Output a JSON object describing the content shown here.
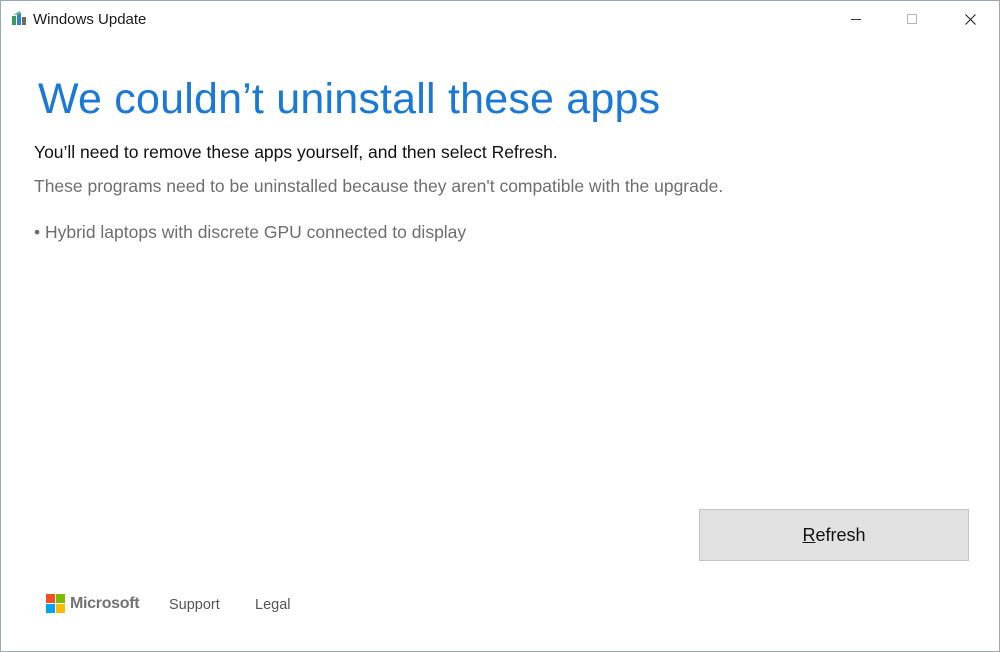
{
  "window": {
    "title": "Windows Update",
    "app_icon": "windows-update-icon",
    "controls": {
      "minimize_icon": "minimize-icon",
      "maximize_icon": "maximize-icon",
      "close_icon": "close-icon"
    }
  },
  "content": {
    "headline": "We couldn’t uninstall these apps",
    "instruction": "You’ll need to remove these apps yourself, and then select Refresh.",
    "explanation": "These programs need to be uninstalled because they aren't compatible with the upgrade.",
    "apps": [
      "• Hybrid laptops with discrete GPU connected to display"
    ]
  },
  "actions": {
    "refresh_label_first": "R",
    "refresh_label_rest": "efresh"
  },
  "footer": {
    "brand": "Microsoft",
    "support": "Support",
    "legal": "Legal"
  },
  "colors": {
    "accent": "#1a78d6",
    "logo_red": "#f25022",
    "logo_green": "#7fba00",
    "logo_blue": "#00a4ef",
    "logo_yellow": "#ffb900"
  }
}
